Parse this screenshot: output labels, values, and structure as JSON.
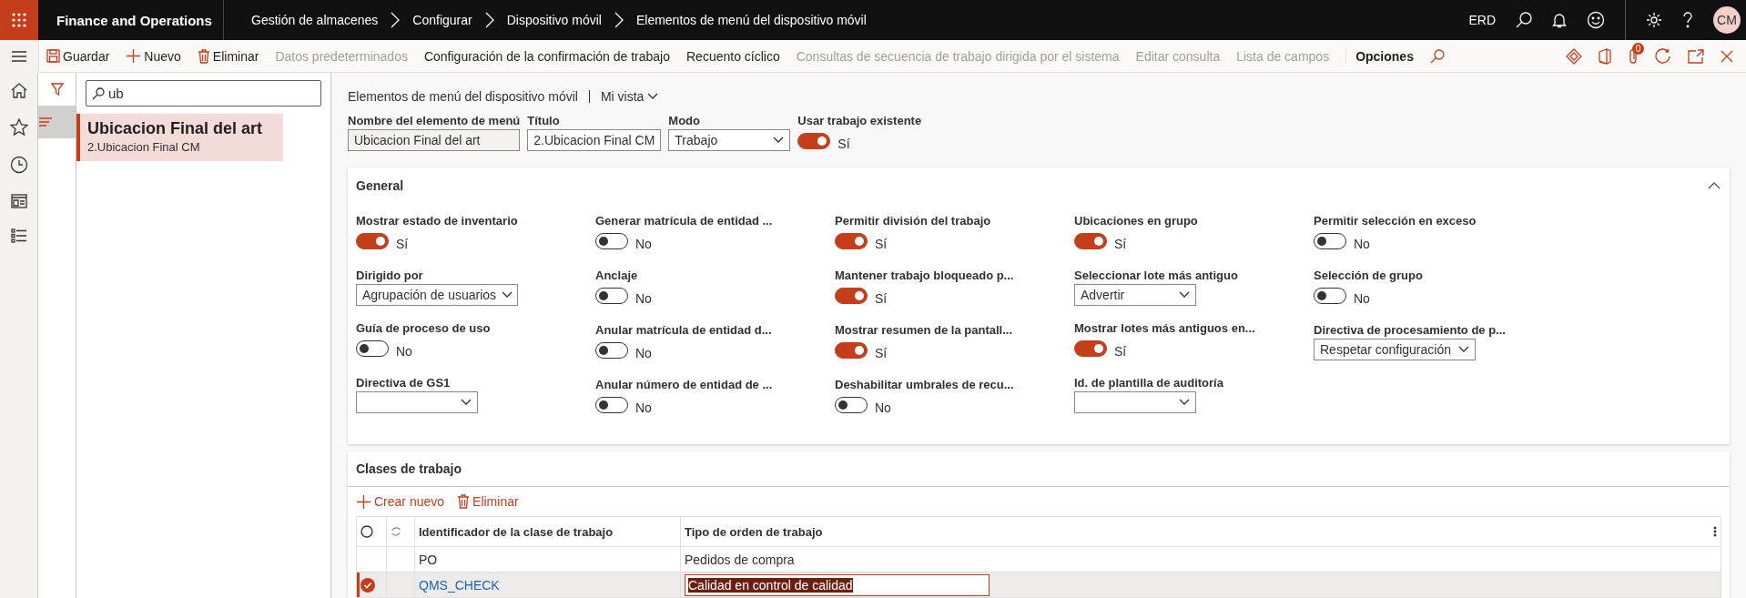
{
  "top_bar": {
    "app_name": "Finance and Operations",
    "breadcrumbs": [
      "Gestión de almacenes",
      "Configurar",
      "Dispositivo móvil",
      "Elementos de menú del dispositivo móvil"
    ],
    "company": "ERD",
    "avatar_initials": "CM"
  },
  "action_bar": {
    "items": [
      {
        "label": "Guardar",
        "kind": "save",
        "disabled": false
      },
      {
        "label": "Nuevo",
        "kind": "new",
        "disabled": false
      },
      {
        "label": "Eliminar",
        "kind": "delete",
        "disabled": false
      },
      {
        "label": "Datos predeterminados",
        "kind": "text",
        "disabled": true
      },
      {
        "label": "Configuración de la confirmación de trabajo",
        "kind": "text",
        "disabled": false
      },
      {
        "label": "Recuento cíclico",
        "kind": "text",
        "disabled": false
      },
      {
        "label": "Consultas de secuencia de trabajo dirigida por el sistema",
        "kind": "text",
        "disabled": true
      },
      {
        "label": "Editar consulta",
        "kind": "text",
        "disabled": true
      },
      {
        "label": "Lista de campos",
        "kind": "text",
        "disabled": true
      }
    ],
    "options_label": "Opciones",
    "attachment_count": "0"
  },
  "list_pane": {
    "search": {
      "value": "ub"
    },
    "items": [
      {
        "title": "Ubicacion Final del art",
        "subtitle": "2.Ubicacion Final CM",
        "selected": true
      }
    ]
  },
  "header": {
    "title": "Elementos de menú del dispositivo móvil",
    "view": "Mi vista",
    "fields": [
      {
        "label": "Nombre del elemento de menú",
        "kind": "readonly",
        "value": "Ubicacion Final del art"
      },
      {
        "label": "Título",
        "kind": "text",
        "value": "2.Ubicacion Final CM"
      },
      {
        "label": "Modo",
        "kind": "select",
        "value": "Trabajo"
      },
      {
        "label": "Usar trabajo existente",
        "kind": "toggle",
        "on": true,
        "state_text": "Sí"
      }
    ]
  },
  "general": {
    "title": "General",
    "expanded": true,
    "columns": [
      {
        "fields": [
          {
            "label": "Mostrar estado de inventario",
            "kind": "toggle",
            "on": true,
            "state_text": "Sí"
          },
          {
            "label": "Dirigido por",
            "kind": "select",
            "value": "Agrupación de usuarios"
          },
          {
            "label": "Guía de proceso de uso",
            "kind": "toggle",
            "on": false,
            "state_text": "No"
          },
          {
            "label": "Directiva de GS1",
            "kind": "select"
          }
        ]
      },
      {
        "fields": [
          {
            "label": "Generar matrícula de entidad ...",
            "kind": "toggle",
            "on": false,
            "state_text": "No"
          },
          {
            "label": "Anclaje",
            "kind": "toggle",
            "on": false,
            "state_text": "No"
          },
          {
            "label": "Anular matrícula de entidad d...",
            "kind": "toggle",
            "on": false,
            "state_text": "No"
          },
          {
            "label": "Anular número de entidad de ...",
            "kind": "toggle",
            "on": false,
            "state_text": "No"
          }
        ]
      },
      {
        "fields": [
          {
            "label": "Permitir división del trabajo",
            "kind": "toggle",
            "on": true,
            "state_text": "Sí"
          },
          {
            "label": "Mantener trabajo bloqueado p...",
            "kind": "toggle",
            "on": true,
            "state_text": "Sí"
          },
          {
            "label": "Mostrar resumen de la pantall...",
            "kind": "toggle",
            "on": true,
            "state_text": "Sí"
          },
          {
            "label": "Deshabilitar umbrales de recu...",
            "kind": "toggle",
            "on": false,
            "state_text": "No"
          }
        ]
      },
      {
        "fields": [
          {
            "label": "Ubicaciones en grupo",
            "kind": "toggle",
            "on": true,
            "state_text": "Sí"
          },
          {
            "label": "Seleccionar lote más antiguo",
            "kind": "select",
            "value": "Advertir"
          },
          {
            "label": "Mostrar lotes más antiguos en...",
            "kind": "toggle",
            "on": true,
            "state_text": "Sí"
          },
          {
            "label": "Id. de plantilla de auditoría",
            "kind": "select"
          }
        ]
      },
      {
        "fields": [
          {
            "label": "Permitir selección en exceso",
            "kind": "toggle",
            "on": false,
            "state_text": "No"
          },
          {
            "label": "Selección de grupo",
            "kind": "toggle",
            "on": false,
            "state_text": "No"
          },
          {
            "label": "Directiva de procesamiento de p...",
            "kind": "select",
            "value": "Respetar configuración"
          }
        ]
      }
    ]
  },
  "work_classes": {
    "title": "Clases de trabajo",
    "toolbar": [
      {
        "label": "Crear nuevo",
        "kind": "new"
      },
      {
        "label": "Eliminar",
        "kind": "delete"
      }
    ],
    "columns": [
      "Identificador de la clase de trabajo",
      "Tipo de orden de trabajo"
    ],
    "rows": [
      {
        "id": "PO",
        "type": "Pedidos de compra",
        "selected": false
      },
      {
        "id": "QMS_CHECK",
        "type": "Calidad en control de calidad",
        "selected": true
      }
    ]
  }
}
